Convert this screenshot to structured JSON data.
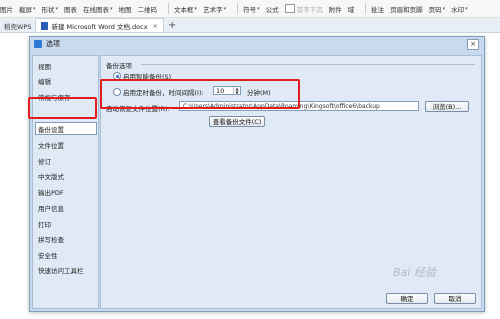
{
  "ribbon": {
    "items": [
      "图片",
      "截屏",
      "形状",
      "图表",
      "在线图表",
      "地图",
      "二维码",
      "文本框",
      "艺术字",
      "符号",
      "公式"
    ],
    "disabled_items": [
      "首字下沉",
      "附件",
      "域"
    ],
    "right_items": [
      "批注",
      "页眉和页脚",
      "页码",
      "水印"
    ]
  },
  "tabs": {
    "prev_label": "稻壳WPS",
    "active_label": "新建 Microsoft Word 文档.docx",
    "close_glyph": "×",
    "add_glyph": "+"
  },
  "dialog": {
    "title": "选项",
    "close_glyph": "×",
    "sidebar": [
      "视图",
      "编辑",
      "常规与保存",
      "备份设置",
      "文件位置",
      "修订",
      "中文版式",
      "输出PDF",
      "用户信息",
      "打印",
      "拼写检查",
      "安全性",
      "快速访问工具栏"
    ],
    "selected_index": 3,
    "group_title": "备份选项",
    "option_smart": "启用智能备份(S)",
    "option_timed": "启用定时备份，时间间隔(I):",
    "interval_value": "10",
    "interval_unit": "分钟(M)",
    "location_label": "启动恢复文件位置(R):",
    "location_path": "C:\\Users\\Administrator\\AppData\\Roaming\\Kingsoft\\office6\\backup",
    "browse_button": "浏览(B)...",
    "view_backup_button": "查看备份文件(C)",
    "ok_button": "确定",
    "cancel_button": "取消"
  },
  "watermark": "Bai 经验"
}
